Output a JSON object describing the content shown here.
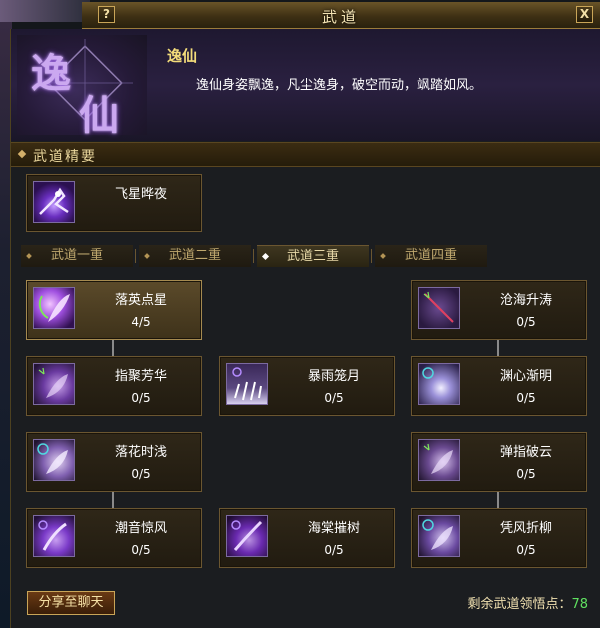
{
  "window": {
    "title": "武道",
    "help_button": "?",
    "close_button": "X"
  },
  "header": {
    "emblem_chars": [
      "逸",
      "仙"
    ],
    "name": "逸仙",
    "description": "逸仙身姿飘逸，凡尘逸身，破空而动，飒踏如风。"
  },
  "section": {
    "title": "武道精要"
  },
  "featured_skill": {
    "name": "飞星晔夜",
    "icon": "flying-star-icon"
  },
  "tabs": [
    {
      "label": "武道一重",
      "active": false
    },
    {
      "label": "武道二重",
      "active": false
    },
    {
      "label": "武道三重",
      "active": true
    },
    {
      "label": "武道四重",
      "active": false
    }
  ],
  "skills": [
    {
      "name": "落英点星",
      "level": "4/5",
      "icon": "falling-petal-icon",
      "learned": true
    },
    {
      "name": "沧海升涛",
      "level": "0/5",
      "icon": "rising-tide-icon",
      "learned": false
    },
    {
      "name": "指聚芳华",
      "level": "0/5",
      "icon": "gather-bloom-icon",
      "learned": false
    },
    {
      "name": "暴雨笼月",
      "level": "0/5",
      "icon": "storm-moon-icon",
      "learned": false
    },
    {
      "name": "渊心渐明",
      "level": "0/5",
      "icon": "abyss-heart-icon",
      "learned": false
    },
    {
      "name": "落花时浅",
      "level": "0/5",
      "icon": "falling-flower-icon",
      "learned": false
    },
    {
      "name": "弹指破云",
      "level": "0/5",
      "icon": "cloud-break-icon",
      "learned": false
    },
    {
      "name": "潮音惊风",
      "level": "0/5",
      "icon": "tide-wind-icon",
      "learned": false
    },
    {
      "name": "海棠摧树",
      "level": "0/5",
      "icon": "crabapple-icon",
      "learned": false
    },
    {
      "name": "凭风折柳",
      "level": "0/5",
      "icon": "wind-willow-icon",
      "learned": false
    }
  ],
  "footer": {
    "share_button": "分享至聊天",
    "points_label": "剩余武道领悟点：",
    "points_value": "78"
  }
}
